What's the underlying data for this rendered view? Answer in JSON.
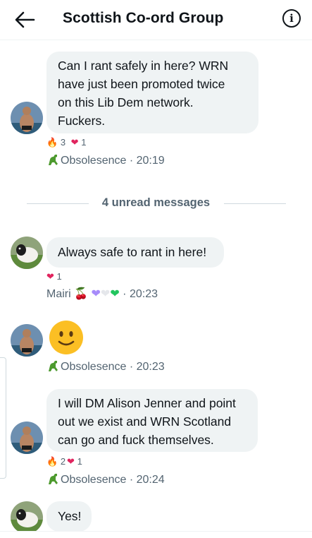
{
  "header": {
    "title": "Scottish Co-ord Group",
    "back_icon": "back-arrow-icon",
    "info_label": "i"
  },
  "separator": {
    "text": "4 unread messages"
  },
  "messages": [
    {
      "text_lines": [
        "Can I rant safely in here? WRN",
        "have just been promoted twice",
        "on this Lib Dem network.",
        "Fuckers."
      ],
      "reactions": [
        {
          "emoji": "fire",
          "count": "3"
        },
        {
          "emoji": "heart",
          "count": "1"
        }
      ],
      "sender": "Obsolesence",
      "time": "20:19"
    },
    {
      "text_lines": [
        "Always safe to rant in here!"
      ],
      "reactions": [
        {
          "emoji": "heart",
          "count": "1"
        }
      ],
      "sender": "Mairi",
      "time": "20:23"
    },
    {
      "text_lines": [
        "🙂"
      ],
      "sender": "Obsolesence",
      "time": "20:23"
    },
    {
      "text_lines": [
        "I will DM Alison Jenner and point",
        "out we exist and WRN Scotland",
        "can go and fuck themselves."
      ],
      "reactions": [
        {
          "emoji": "fire",
          "count": "2"
        },
        {
          "emoji": "heart",
          "count": "1"
        }
      ],
      "sender": "Obsolesence",
      "time": "20:24"
    },
    {
      "text_lines": [
        "Yes!"
      ]
    }
  ],
  "separator_dot": "·",
  "colors": {
    "heart": "#e0245e",
    "fire": "#f59e0b",
    "purple_heart": "#a78bfa",
    "white_heart": "#e5e7eb",
    "green_heart": "#22c55e",
    "dino": "#4d9a2e"
  }
}
